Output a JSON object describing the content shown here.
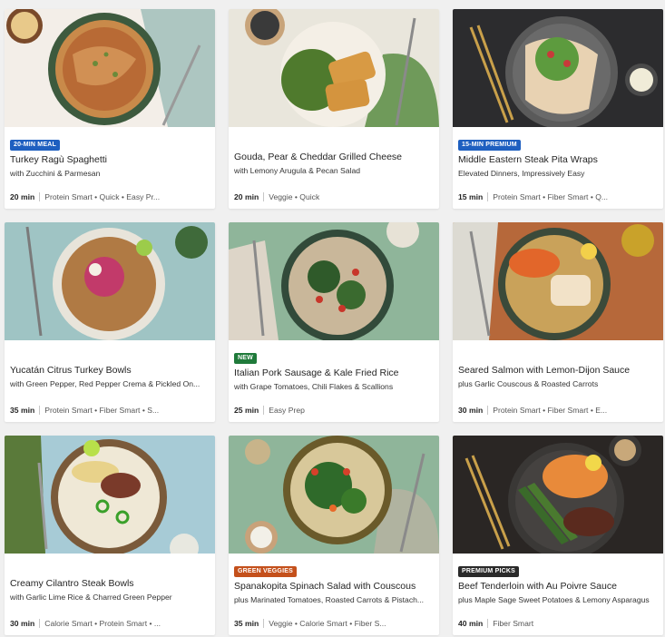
{
  "recipes": [
    {
      "badge": "20-MIN MEAL",
      "badge_color": "#1e5fc0",
      "title": "Turkey Ragù Spaghetti",
      "subtitle": "with Zucchini & Parmesan",
      "time": "20 min",
      "tags": "Protein Smart • Quick • Easy Pr...",
      "image": "spaghetti-bowl"
    },
    {
      "badge": "",
      "badge_color": "",
      "title": "Gouda, Pear & Cheddar Grilled Cheese",
      "subtitle": "with Lemony Arugula & Pecan Salad",
      "time": "20 min",
      "tags": "Veggie • Quick",
      "image": "grilled-cheese-plate"
    },
    {
      "badge": "15-MIN PREMIUM",
      "badge_color": "#1e5fc0",
      "title": "Middle Eastern Steak Pita Wraps",
      "subtitle": "Elevated Dinners, Impressively Easy",
      "time": "15 min",
      "tags": "Protein Smart • Fiber Smart • Q...",
      "image": "pita-wrap-plate"
    },
    {
      "badge": "",
      "badge_color": "",
      "title": "Yucatán Citrus Turkey Bowls",
      "subtitle": "with Green Pepper, Red Pepper Crema & Pickled On...",
      "time": "35 min",
      "tags": "Protein Smart • Fiber Smart • S...",
      "image": "turkey-rice-bowl"
    },
    {
      "badge": "NEW",
      "badge_color": "#1f7a3a",
      "title": "Italian Pork Sausage & Kale Fried Rice",
      "subtitle": "with Grape Tomatoes, Chili Flakes & Scallions",
      "time": "25 min",
      "tags": "Easy Prep",
      "image": "fried-rice-bowl"
    },
    {
      "badge": "",
      "badge_color": "",
      "title": "Seared Salmon with Lemon-Dijon Sauce",
      "subtitle": "plus Garlic Couscous & Roasted Carrots",
      "time": "30 min",
      "tags": "Protein Smart • Fiber Smart • E...",
      "image": "salmon-couscous-plate"
    },
    {
      "badge": "",
      "badge_color": "",
      "title": "Creamy Cilantro Steak Bowls",
      "subtitle": "with Garlic Lime Rice & Charred Green Pepper",
      "time": "30 min",
      "tags": "Calorie Smart • Protein Smart • ...",
      "image": "steak-rice-bowl"
    },
    {
      "badge": "GREEN VEGGIES",
      "badge_color": "#c4501b",
      "title": "Spanakopita Spinach Salad with Couscous",
      "subtitle": "plus Marinated Tomatoes, Roasted Carrots & Pistach...",
      "time": "35 min",
      "tags": "Veggie • Calorie Smart • Fiber S...",
      "image": "spinach-salad-plate"
    },
    {
      "badge": "PREMIUM PICKS",
      "badge_color": "#2a2a2a",
      "title": "Beef Tenderloin with Au Poivre Sauce",
      "subtitle": "plus Maple Sage Sweet Potatoes & Lemony Asparagus",
      "time": "40 min",
      "tags": "Fiber Smart",
      "image": "beef-tenderloin-plate"
    }
  ]
}
